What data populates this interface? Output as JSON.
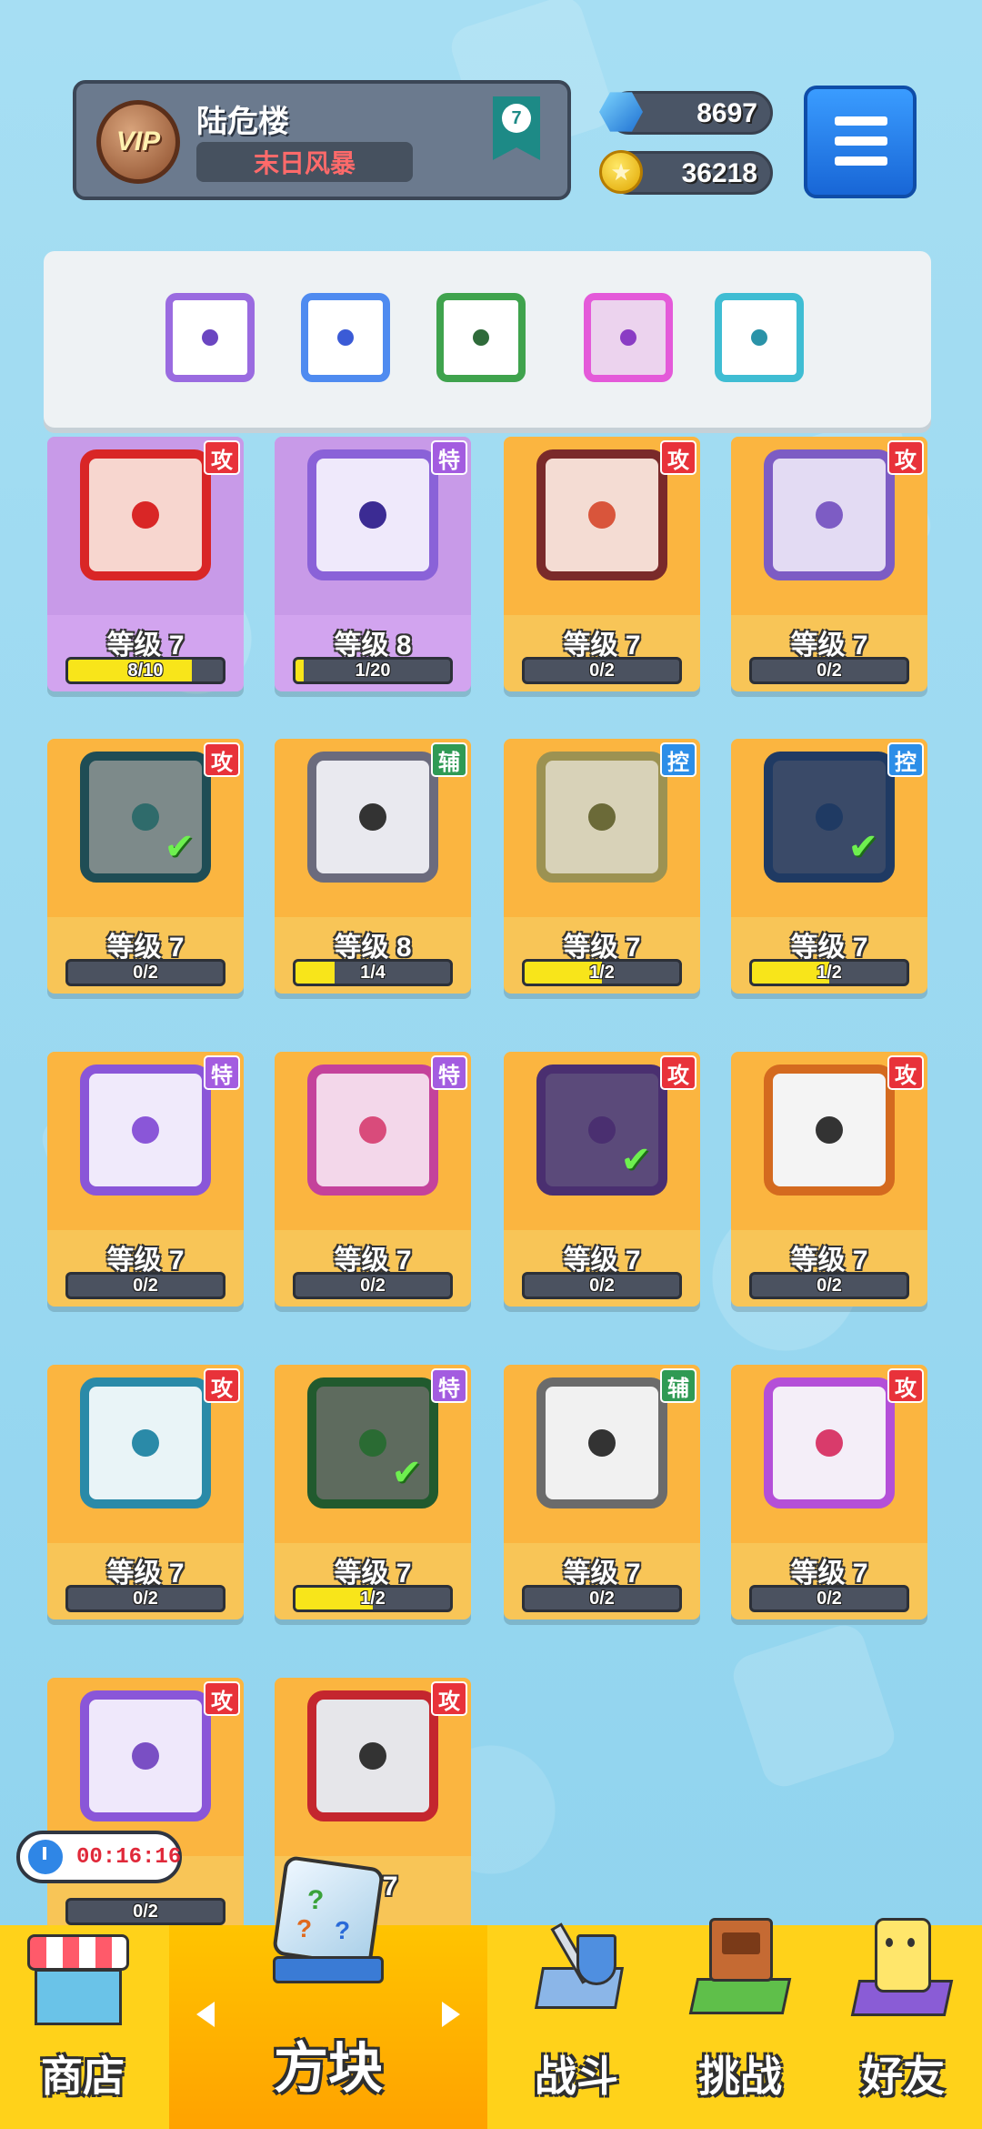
{
  "header": {
    "vip_label": "VIP",
    "username": "陆危楼",
    "title": "末日风暴",
    "rank": "7",
    "gems": "8697",
    "coins": "36218"
  },
  "equipped": [
    {
      "color": "#9a6be0",
      "pip": "#6b46c1"
    },
    {
      "color": "#4f8bf0",
      "pip": "#3b5bd6"
    },
    {
      "color": "#3fa34d",
      "pip": "#2f6b3a"
    },
    {
      "color": "#e45ad9",
      "pip": "#8a3cc4"
    },
    {
      "color": "#3fbdd3",
      "pip": "#2a93a8"
    }
  ],
  "dice": [
    {
      "level": "等级 7",
      "progress": "8/10",
      "fill": 0.8,
      "tag": "攻",
      "tag_color": "#e8323a",
      "frame": "#d92626",
      "bg": "#f7d6cf",
      "pip": "#d92626",
      "card": "purple",
      "checked": false
    },
    {
      "level": "等级 8",
      "progress": "1/20",
      "fill": 0.05,
      "tag": "特",
      "tag_color": "#a35ce0",
      "frame": "#8a62d8",
      "bg": "#efe9fb",
      "pip": "#3b2b93",
      "card": "purple",
      "checked": false
    },
    {
      "level": "等级 7",
      "progress": "0/2",
      "fill": 0,
      "tag": "攻",
      "tag_color": "#e8323a",
      "frame": "#7a2a2a",
      "bg": "#f4dcd3",
      "pip": "#d9553b",
      "card": "yellow",
      "checked": false
    },
    {
      "level": "等级 7",
      "progress": "0/2",
      "fill": 0,
      "tag": "攻",
      "tag_color": "#e8323a",
      "frame": "#7d5cc4",
      "bg": "#e3dbf3",
      "pip": "#7d5cc4",
      "card": "yellow",
      "checked": false
    },
    {
      "level": "等级 7",
      "progress": "0/2",
      "fill": 0,
      "tag": "攻",
      "tag_color": "#e8323a",
      "frame": "#1f4d55",
      "bg": "#7d8a8a",
      "pip": "#2f6b6b",
      "card": "yellow",
      "checked": true
    },
    {
      "level": "等级 8",
      "progress": "1/4",
      "fill": 0.25,
      "tag": "辅",
      "tag_color": "#2f9a54",
      "frame": "#6b6b7d",
      "bg": "#e9e9ef",
      "pip": "#333333",
      "card": "yellow",
      "checked": false
    },
    {
      "level": "等级 7",
      "progress": "1/2",
      "fill": 0.5,
      "tag": "控",
      "tag_color": "#2c8ee8",
      "frame": "#9c9252",
      "bg": "#d8d2b8",
      "pip": "#6b6a38",
      "card": "yellow",
      "checked": false
    },
    {
      "level": "等级 7",
      "progress": "1/2",
      "fill": 0.5,
      "tag": "控",
      "tag_color": "#2c8ee8",
      "frame": "#1f3a63",
      "bg": "#3a4a68",
      "pip": "#1f3a63",
      "card": "yellow",
      "checked": true
    },
    {
      "level": "等级 7",
      "progress": "0/2",
      "fill": 0,
      "tag": "特",
      "tag_color": "#a35ce0",
      "frame": "#8a56d8",
      "bg": "#f0eafb",
      "pip": "#8a56d8",
      "card": "yellow",
      "checked": false
    },
    {
      "level": "等级 7",
      "progress": "0/2",
      "fill": 0,
      "tag": "特",
      "tag_color": "#a35ce0",
      "frame": "#c4429b",
      "bg": "#f3d7ea",
      "pip": "#d94b7b",
      "card": "yellow",
      "checked": false
    },
    {
      "level": "等级 7",
      "progress": "0/2",
      "fill": 0,
      "tag": "攻",
      "tag_color": "#e8323a",
      "frame": "#4a2f70",
      "bg": "#5b4a7a",
      "pip": "#4a2f70",
      "card": "yellow",
      "checked": true
    },
    {
      "level": "等级 7",
      "progress": "0/2",
      "fill": 0,
      "tag": "攻",
      "tag_color": "#e8323a",
      "frame": "#d46a1f",
      "bg": "#f4f4f4",
      "pip": "#333333",
      "card": "yellow",
      "checked": false
    },
    {
      "level": "等级 7",
      "progress": "0/2",
      "fill": 0,
      "tag": "攻",
      "tag_color": "#e8323a",
      "frame": "#2a8aa8",
      "bg": "#e9f4f7",
      "pip": "#2a8aa8",
      "card": "yellow",
      "checked": false
    },
    {
      "level": "等级 7",
      "progress": "1/2",
      "fill": 0.5,
      "tag": "特",
      "tag_color": "#a35ce0",
      "frame": "#215a2e",
      "bg": "#5e6b5e",
      "pip": "#2a6b33",
      "card": "yellow",
      "checked": true
    },
    {
      "level": "等级 7",
      "progress": "0/2",
      "fill": 0,
      "tag": "辅",
      "tag_color": "#2f9a54",
      "frame": "#6b6b6b",
      "bg": "#f1f1f1",
      "pip": "#333333",
      "card": "yellow",
      "checked": false
    },
    {
      "level": "等级 7",
      "progress": "0/2",
      "fill": 0,
      "tag": "攻",
      "tag_color": "#e8323a",
      "frame": "#b44fd8",
      "bg": "#f4eef8",
      "pip": "#d93b6b",
      "card": "yellow",
      "checked": false
    },
    {
      "level": "",
      "progress": "0/2",
      "fill": 0,
      "tag": "攻",
      "tag_color": "#e8323a",
      "frame": "#8a56d8",
      "bg": "#efe8fb",
      "pip": "#7a4fc4",
      "card": "yellow",
      "checked": false
    },
    {
      "level": "级 7",
      "progress": "",
      "fill": 0,
      "tag": "攻",
      "tag_color": "#e8323a",
      "frame": "#c4262e",
      "bg": "#e6e6ea",
      "pip": "#333333",
      "card": "yellow",
      "checked": false
    }
  ],
  "timer": "00:16:16",
  "nav": {
    "shop": "商店",
    "dice": "方块",
    "battle": "战斗",
    "challenge": "挑战",
    "friends": "好友"
  }
}
